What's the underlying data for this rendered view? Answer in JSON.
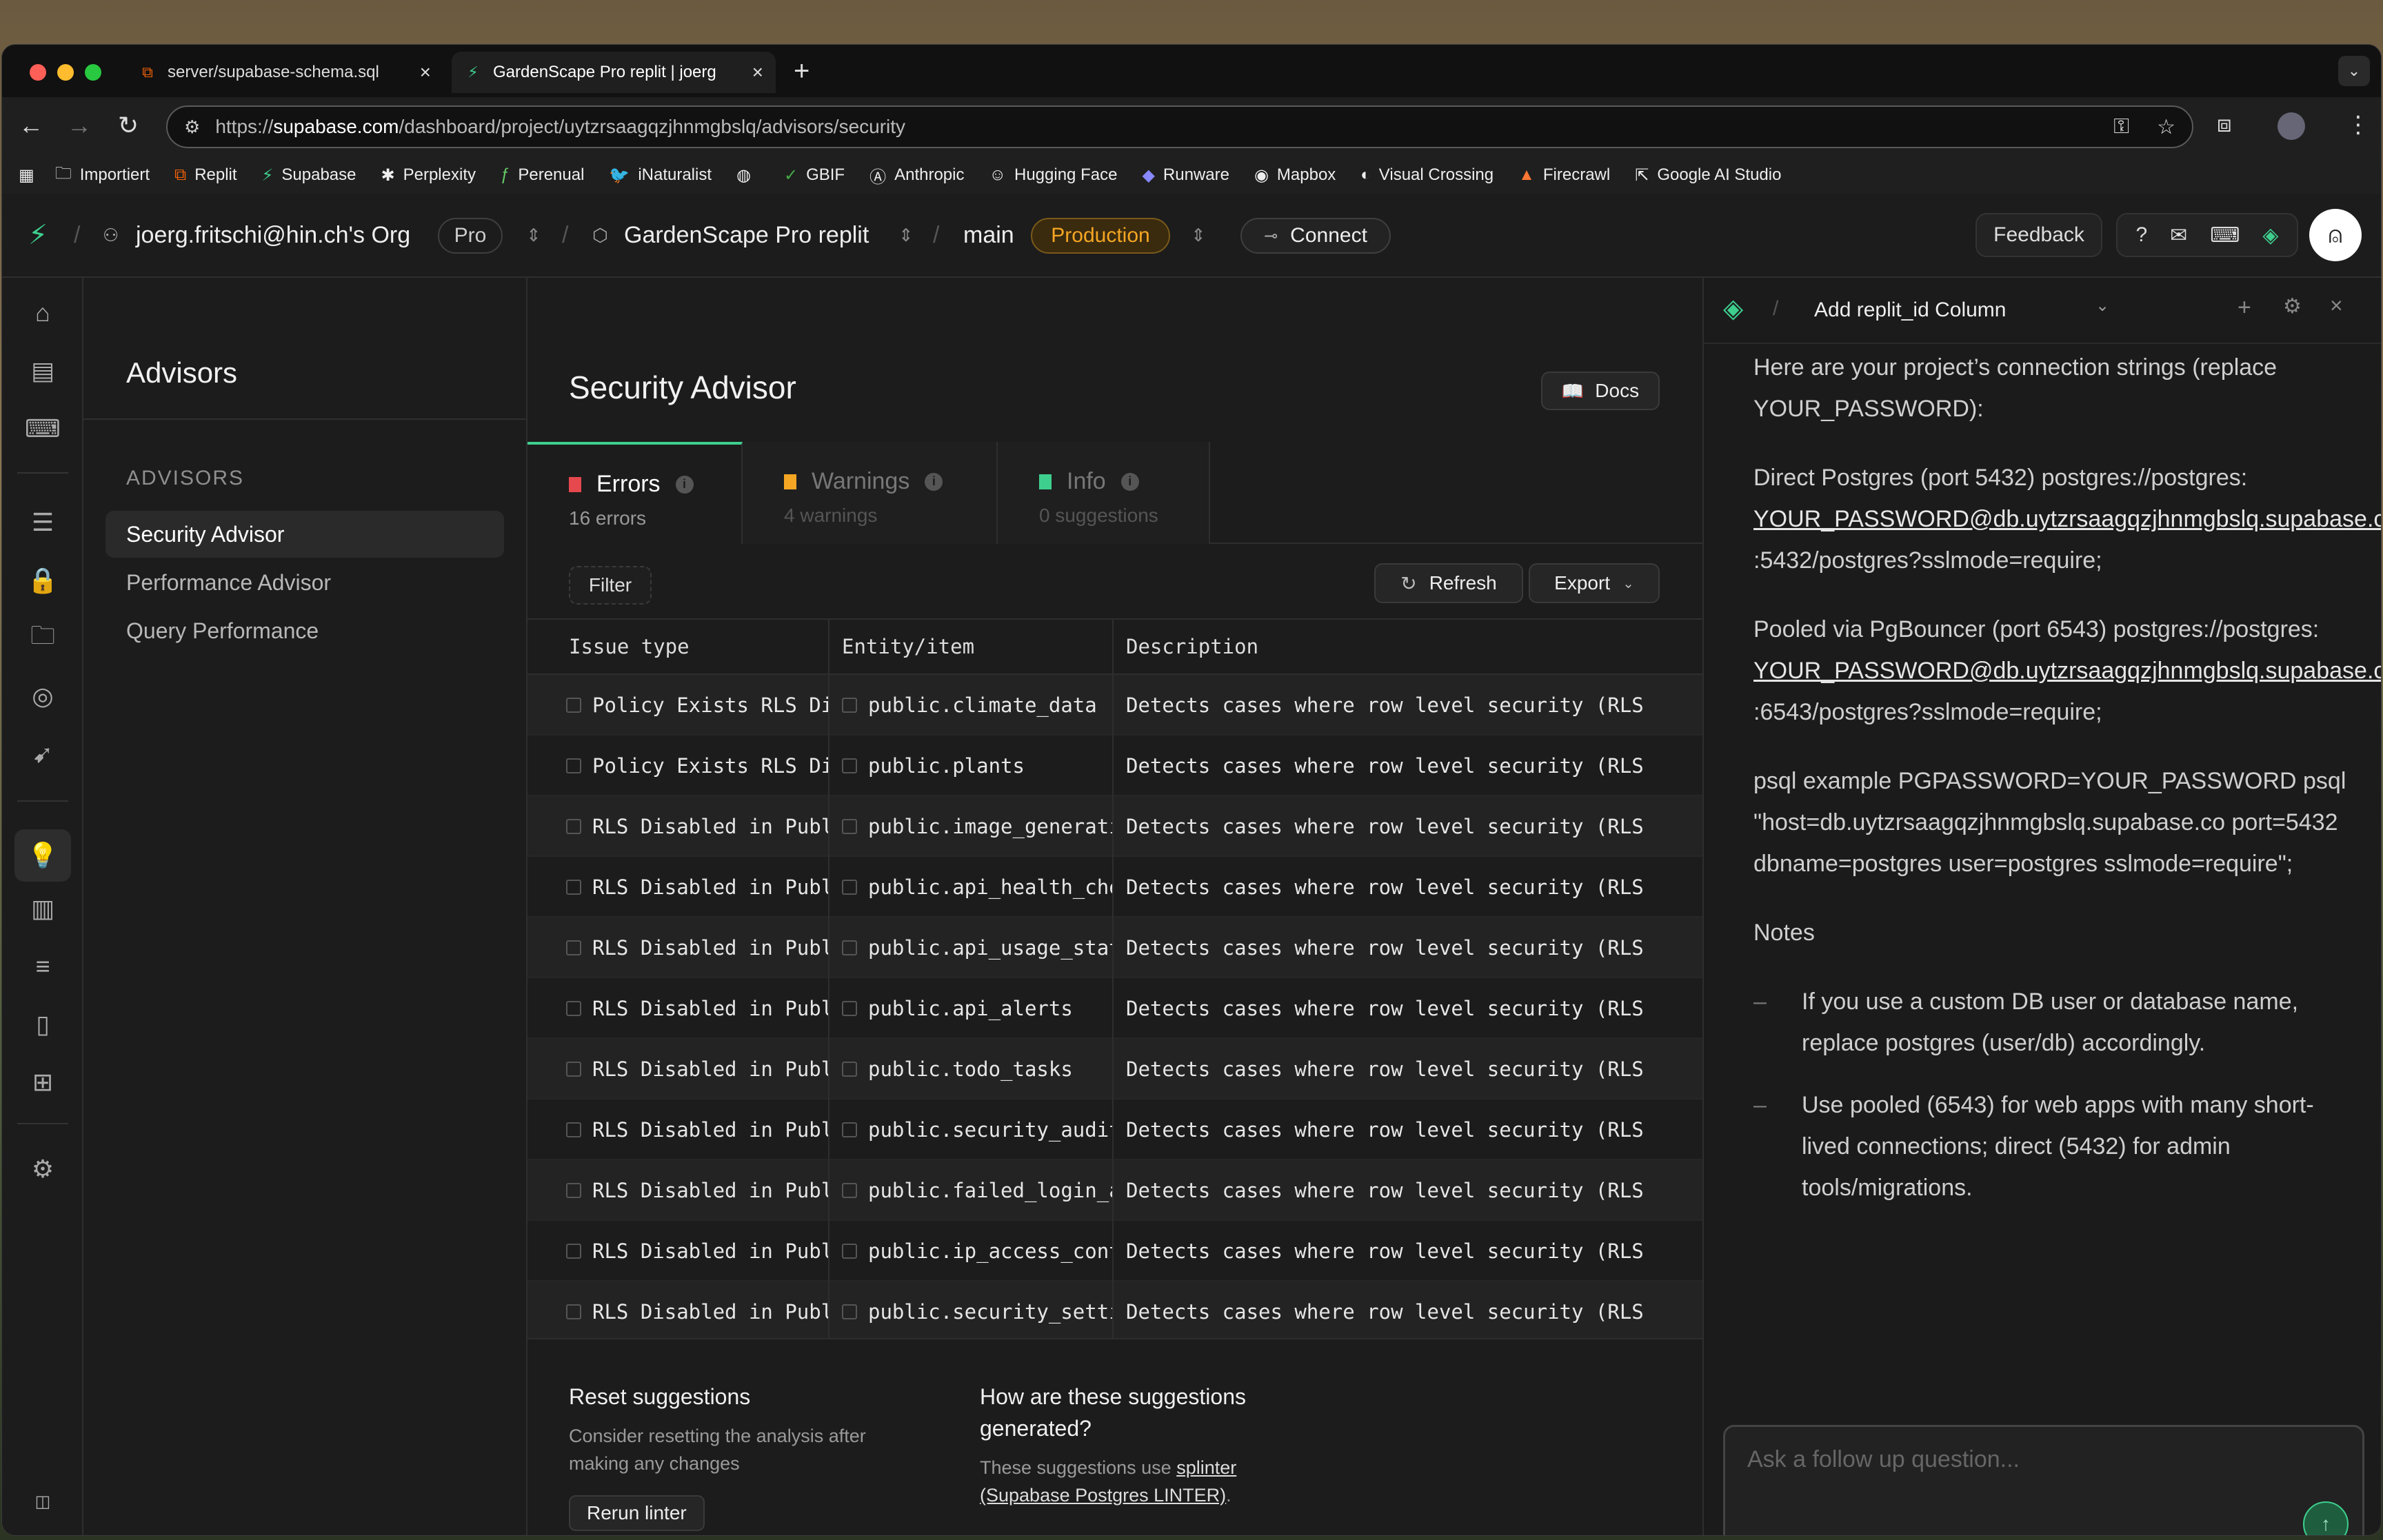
{
  "browser": {
    "tabs": [
      {
        "title": "server/supabase-schema.sql",
        "active": false
      },
      {
        "title": "GardenScape Pro replit | joerg",
        "active": true
      }
    ],
    "url_prefix": "https://",
    "url_host": "supabase.com",
    "url_path": "/dashboard/project/uytzrsaagqzjhnmgbslq/advisors/security",
    "bookmarks": [
      "Importiert",
      "Replit",
      "Supabase",
      "Perplexity",
      "Perenual",
      "iNaturalist",
      "",
      "GBIF",
      "Anthropic",
      "Hugging Face",
      "Runware",
      "Mapbox",
      "Visual Crossing",
      "Firecrawl",
      "Google AI Studio"
    ]
  },
  "header": {
    "org": "joerg.fritschi@hin.ch's Org",
    "plan": "Pro",
    "project": "GardenScape Pro replit",
    "branch": "main",
    "env": "Production",
    "connect": "Connect",
    "feedback": "Feedback"
  },
  "sidemenu": {
    "title": "Advisors",
    "section": "ADVISORS",
    "items": [
      "Security Advisor",
      "Performance Advisor",
      "Query Performance"
    ]
  },
  "main": {
    "title": "Security Advisor",
    "docs": "Docs",
    "tabs": [
      {
        "label": "Errors",
        "sub": "16 errors"
      },
      {
        "label": "Warnings",
        "sub": "4 warnings"
      },
      {
        "label": "Info",
        "sub": "0 suggestions"
      }
    ],
    "filter": "Filter",
    "refresh": "Refresh",
    "export": "Export",
    "columns": [
      "Issue type",
      "Entity/item",
      "Description"
    ],
    "rows": [
      [
        "Policy Exists RLS Disabled",
        "public.climate_data",
        "Detects cases where row level security (RLS"
      ],
      [
        "Policy Exists RLS Disabled",
        "public.plants",
        "Detects cases where row level security (RLS"
      ],
      [
        "RLS Disabled in Public",
        "public.image_generations",
        "Detects cases where row level security (RLS"
      ],
      [
        "RLS Disabled in Public",
        "public.api_health_checks",
        "Detects cases where row level security (RLS"
      ],
      [
        "RLS Disabled in Public",
        "public.api_usage_stats",
        "Detects cases where row level security (RLS"
      ],
      [
        "RLS Disabled in Public",
        "public.api_alerts",
        "Detects cases where row level security (RLS"
      ],
      [
        "RLS Disabled in Public",
        "public.todo_tasks",
        "Detects cases where row level security (RLS"
      ],
      [
        "RLS Disabled in Public",
        "public.security_audit_log",
        "Detects cases where row level security (RLS"
      ],
      [
        "RLS Disabled in Public",
        "public.failed_login_attempts",
        "Detects cases where row level security (RLS"
      ],
      [
        "RLS Disabled in Public",
        "public.ip_access_control",
        "Detects cases where row level security (RLS"
      ],
      [
        "RLS Disabled in Public",
        "public.security_settings",
        "Detects cases where row level security (RLS"
      ]
    ],
    "reset_title": "Reset suggestions",
    "reset_text": "Consider resetting the analysis after making any changes",
    "rerun": "Rerun linter",
    "how_title": "How are these suggestions generated?",
    "how_text_prefix": "These suggestions use ",
    "how_link": "splinter (Supabase Postgres LINTER)",
    "how_text_suffix": "."
  },
  "assistant": {
    "title": "Add replit_id Column",
    "intro": "Here are your project’s connection strings (replace YOUR_PASSWORD):",
    "direct_label": "Direct Postgres (port 5432) postgres://postgres:",
    "direct_host": "YOUR_PASSWORD@db.uytzrsaagqzjhnmgbslq.supabase.co",
    "direct_tail": ":5432/postgres?sslmode=require;",
    "pooled_label": "Pooled via PgBouncer (port 6543) postgres://postgres:",
    "pooled_host": "YOUR_PASSWORD@db.uytzrsaagqzjhnmgbslq.supabase.co",
    "pooled_tail": ":6543/postgres?sslmode=require;",
    "psql": "psql example PGPASSWORD=YOUR_PASSWORD psql \"host=db.uytzrsaagqzjhnmgbslq.supabase.co port=5432 dbname=postgres user=postgres sslmode=require\";",
    "notes_title": "Notes",
    "notes": [
      "If you use a custom DB user or database name, replace postgres (user/db) accordingly.",
      "Use pooled (6543) for web apps with many short-lived connections; direct (5432) for admin tools/migrations."
    ],
    "placeholder": "Ask a follow up question..."
  },
  "colors": {
    "accent": "#3ecf8e",
    "error_flag": "#e5484d",
    "warning_flag": "#f5a623",
    "production_badge": "#f5a623"
  }
}
